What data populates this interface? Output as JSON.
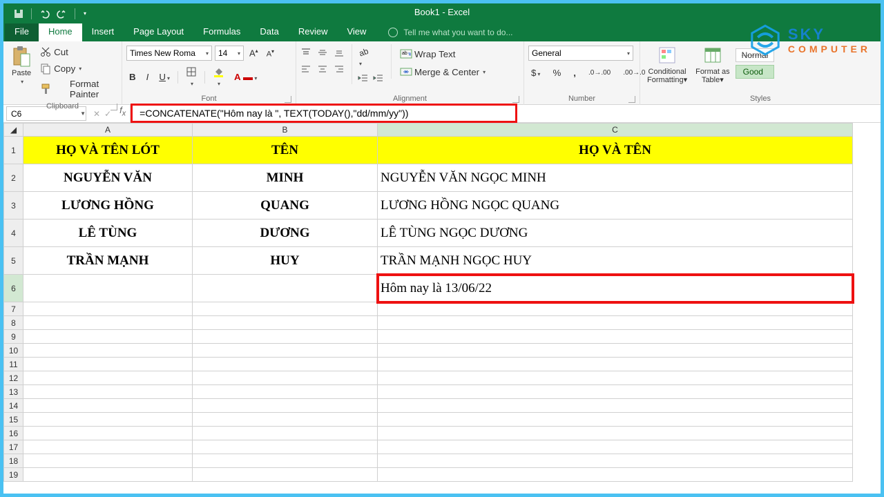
{
  "title": "Book1 - Excel",
  "qat": {
    "undo_tip": "Undo",
    "redo_tip": "Redo",
    "save_tip": "Save"
  },
  "tabs": {
    "file": "File",
    "home": "Home",
    "insert": "Insert",
    "pagelayout": "Page Layout",
    "formulas": "Formulas",
    "data": "Data",
    "review": "Review",
    "view": "View",
    "tellme": "Tell me what you want to do..."
  },
  "ribbon": {
    "clipboard": {
      "paste": "Paste",
      "cut": "Cut",
      "copy": "Copy",
      "painter": "Format Painter",
      "label": "Clipboard"
    },
    "font": {
      "family": "Times New Roma",
      "size": "14",
      "label": "Font"
    },
    "alignment": {
      "wrap": "Wrap Text",
      "merge": "Merge & Center",
      "label": "Alignment"
    },
    "number": {
      "format": "General",
      "label": "Number"
    },
    "styles": {
      "cond": "Conditional Formatting",
      "table": "Format as Table",
      "normal": "Normal",
      "good": "Good",
      "label": "Styles"
    }
  },
  "fbar": {
    "name": "C6",
    "formula": "=CONCATENATE(\"Hôm nay là \", TEXT(TODAY(),\"dd/mm/yy\"))"
  },
  "columns": [
    "A",
    "B",
    "C"
  ],
  "header_row": {
    "a": "HỌ VÀ TÊN LÓT",
    "b": "TÊN",
    "c": "HỌ VÀ TÊN"
  },
  "rows": [
    {
      "a": "NGUYỄN VĂN",
      "b": "MINH",
      "c": "NGUYỄN VĂN  NGỌC MINH"
    },
    {
      "a": "LƯƠNG HỒNG",
      "b": "QUANG",
      "c": "LƯƠNG HỒNG NGỌC QUANG"
    },
    {
      "a": "LÊ TÙNG",
      "b": "DƯƠNG",
      "c": "LÊ TÙNG NGỌC DƯƠNG"
    },
    {
      "a": "TRẦN MẠNH",
      "b": "HUY",
      "c": "TRẦN MẠNH NGỌC HUY"
    }
  ],
  "c6_value": "Hôm nay là 13/06/22",
  "watermark": {
    "line1": "SKY",
    "line2": "COMPUTER"
  }
}
